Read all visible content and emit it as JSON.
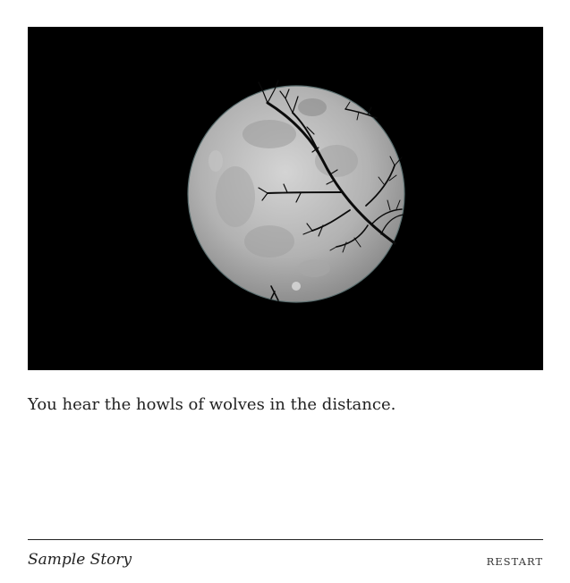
{
  "passage": {
    "image": {
      "subject": "full-moon-with-bare-branches"
    },
    "text": "You hear the howls of wolves in the distance."
  },
  "footer": {
    "story_title": "Sample Story",
    "restart_label": "RESTART"
  },
  "colors": {
    "background": "#ffffff",
    "text": "#222222",
    "image_background": "#000000",
    "moon": "#b9b9b9"
  }
}
